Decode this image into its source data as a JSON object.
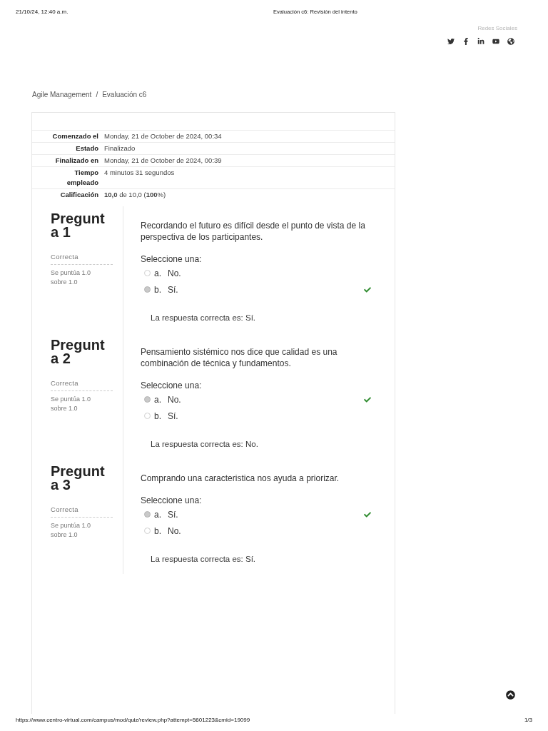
{
  "print_header": {
    "date": "21/10/24, 12:40 a.m.",
    "title": "Evaluación c6: Revisión del intento"
  },
  "social": {
    "label": "Redes Sociales"
  },
  "breadcrumb": {
    "items": [
      "Agile Management",
      "Evaluación c6"
    ],
    "separator": "/"
  },
  "summary": [
    {
      "label": "Comenzado el",
      "value": "Monday, 21 de October de 2024, 00:34"
    },
    {
      "label": "Estado",
      "value": "Finalizado"
    },
    {
      "label": "Finalizado en",
      "value": "Monday, 21 de October de 2024, 00:39"
    },
    {
      "label": "Tiempo empleado",
      "value": "4 minutos 31 segundos"
    },
    {
      "label": "Calificación",
      "value": "**10,0** de 10,0 (**100**%)"
    }
  ],
  "questions": [
    {
      "title": "Pregunta 1",
      "status": "Correcta",
      "score": "Se puntúa 1.0 sobre 1.0",
      "text": "Recordando el futuro es difícil desde el punto de vista de la perspectiva de los participantes.",
      "prompt": "Seleccione una:",
      "options": [
        {
          "letter": "a.",
          "text": "No.",
          "selected": false,
          "correct": false
        },
        {
          "letter": "b.",
          "text": "Sí.",
          "selected": true,
          "correct": true
        }
      ],
      "feedback": "La respuesta correcta es: Sí."
    },
    {
      "title": "Pregunta 2",
      "status": "Correcta",
      "score": "Se puntúa 1.0 sobre 1.0",
      "text": "Pensamiento sistémico nos dice que calidad es una combinación de técnica y fundamentos.",
      "prompt": "Seleccione una:",
      "options": [
        {
          "letter": "a.",
          "text": "No.",
          "selected": true,
          "correct": true
        },
        {
          "letter": "b.",
          "text": "Sí.",
          "selected": false,
          "correct": false
        }
      ],
      "feedback": "La respuesta correcta es: No."
    },
    {
      "title": "Pregunta 3",
      "status": "Correcta",
      "score": "Se puntúa 1.0 sobre 1.0",
      "text": "Comprando una caracteristica nos ayuda a priorizar.",
      "prompt": "Seleccione una:",
      "options": [
        {
          "letter": "a.",
          "text": "Sí.",
          "selected": true,
          "correct": true
        },
        {
          "letter": "b.",
          "text": "No.",
          "selected": false,
          "correct": false
        }
      ],
      "feedback": "La respuesta correcta es: Sí."
    }
  ],
  "print_footer": {
    "url": "https://www.centro-virtual.com/campus/mod/quiz/review.php?attempt=5601223&cmid=19099",
    "page": "1/3"
  }
}
